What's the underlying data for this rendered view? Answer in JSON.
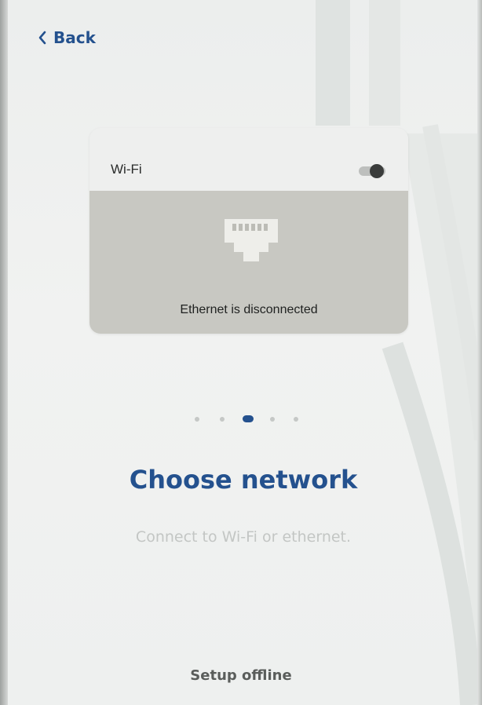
{
  "header": {
    "back_label": "Back"
  },
  "network_card": {
    "wifi_label": "Wi-Fi",
    "wifi_enabled": false,
    "ethernet_status": "Ethernet is disconnected"
  },
  "pager": {
    "total": 5,
    "current": 3
  },
  "main": {
    "title": "Choose network",
    "subtitle": "Connect to Wi-Fi or ethernet."
  },
  "footer": {
    "setup_offline_label": "Setup offline"
  },
  "colors": {
    "accent": "#24518e",
    "background": "#eef0ef",
    "ethernet_panel": "#c8c8c2",
    "muted_text": "#c3c6c4"
  },
  "icons": {
    "back": "chevron-left-icon",
    "toggle": "toggle-switch",
    "ethernet": "ethernet-port-icon"
  }
}
